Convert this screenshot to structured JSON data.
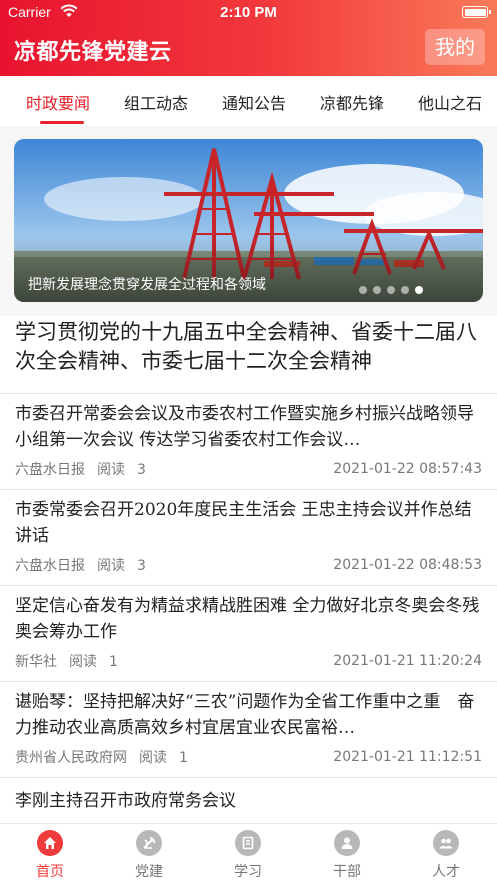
{
  "status_bar": {
    "carrier": "Carrier",
    "time": "2:10 PM"
  },
  "header": {
    "title": "凉都先锋党建云",
    "mine_button": "我的"
  },
  "tabs": [
    {
      "label": "时政要闻",
      "active": true
    },
    {
      "label": "组工动态",
      "active": false
    },
    {
      "label": "通知公告",
      "active": false
    },
    {
      "label": "凉都先锋",
      "active": false
    },
    {
      "label": "他山之石",
      "active": false
    }
  ],
  "banner": {
    "caption": "把新发展理念贯穿发展全过程和各领域",
    "dots": 5,
    "active_dot": 5
  },
  "headline": "学习贯彻党的十九届五中全会精神、省委十二届八次全会精神、市委七届十二次全会精神",
  "news": [
    {
      "title": "市委召开常委会会议及市委农村工作暨实施乡村振兴战略领导小组第一次会议 传达学习省委农村工作会议…",
      "source": "六盘水日报",
      "read_label": "阅读",
      "read_count": "3",
      "time": "2021-01-22 08:57:43"
    },
    {
      "title": "市委常委会召开2020年度民主生活会 王忠主持会议并作总结讲话",
      "source": "六盘水日报",
      "read_label": "阅读",
      "read_count": "3",
      "time": "2021-01-22 08:48:53"
    },
    {
      "title": "坚定信心奋发有为精益求精战胜困难 全力做好北京冬奥会冬残奥会筹办工作",
      "source": "新华社",
      "read_label": "阅读",
      "read_count": "1",
      "time": "2021-01-21 11:20:24"
    },
    {
      "title": "谌贻琴：坚持把解决好“三农”问题作为全省工作重中之重　奋力推动农业高质高效乡村宜居宜业农民富裕…",
      "source": "贵州省人民政府网",
      "read_label": "阅读",
      "read_count": "1",
      "time": "2021-01-21 11:12:51"
    },
    {
      "title": "李刚主持召开市政府常务会议"
    }
  ],
  "tabbar": [
    {
      "label": "首页",
      "icon": "home-icon",
      "active": true
    },
    {
      "label": "党建",
      "icon": "party-emblem-icon",
      "active": false
    },
    {
      "label": "学习",
      "icon": "book-icon",
      "active": false
    },
    {
      "label": "干部",
      "icon": "cadre-icon",
      "active": false
    },
    {
      "label": "人才",
      "icon": "talent-icon",
      "active": false
    }
  ],
  "colors": {
    "brand_red": "#e8132f",
    "active_red": "#ef3b3b",
    "gradient_end": "#f97a5a"
  }
}
